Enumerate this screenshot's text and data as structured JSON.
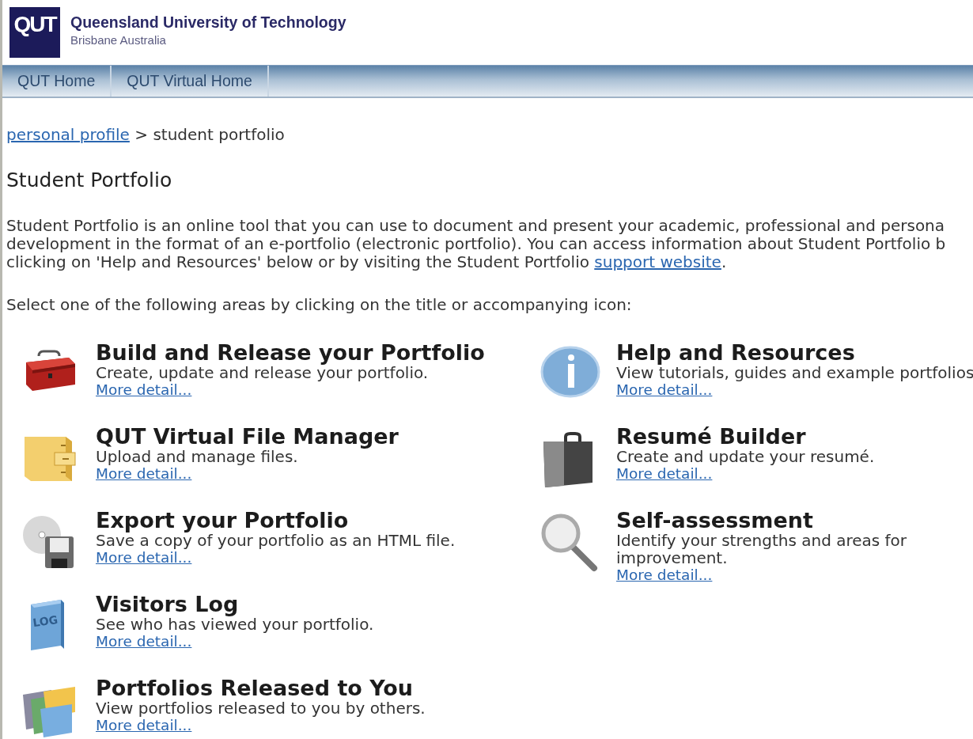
{
  "header": {
    "logo": "QUT",
    "name": "Queensland University of Technology",
    "place": "Brisbane Australia"
  },
  "nav": [
    {
      "label": "QUT Home"
    },
    {
      "label": "QUT Virtual Home"
    }
  ],
  "breadcrumb": {
    "link": "personal profile",
    "separator": ">",
    "current": "student portfolio"
  },
  "heading": "Student Portfolio",
  "intro": {
    "lines": [
      "Student Portfolio is an online tool that you can use to document and present your academic, professional and persona",
      "development in the format of an e-portfolio (electronic portfolio). You can access information about Student Portfolio b",
      "clicking on 'Help and Resources' below or by visiting the Student Portfolio "
    ],
    "link": "support website",
    "after": "."
  },
  "instruction": "Select one of the following areas by clicking on the title or accompanying icon:",
  "columns": [
    [
      {
        "kind": "toolbox",
        "title": "Build and Release your Portfolio",
        "description": [
          "Create, update and release your portfolio."
        ],
        "link": "More detail..."
      },
      {
        "kind": "cabinet",
        "title": "QUT Virtual File Manager",
        "description": [
          "Upload and manage files."
        ],
        "link": "More detail..."
      },
      {
        "kind": "export",
        "title": "Export your Portfolio",
        "description": [
          "Save a copy of your portfolio as an HTML file."
        ],
        "link": "More detail..."
      },
      {
        "kind": "book",
        "icon_text": "LOG",
        "title": "Visitors Log",
        "description": [
          "See who has viewed your portfolio."
        ],
        "link": "More detail..."
      },
      {
        "kind": "folders",
        "title": "Portfolios Released to You",
        "description": [
          "View portfolios released to you by others."
        ],
        "link": "More detail..."
      }
    ],
    [
      {
        "kind": "info",
        "title": "Help and Resources",
        "description": [
          "View tutorials, guides and example portfolios"
        ],
        "link": "More detail..."
      },
      {
        "kind": "briefcase",
        "title": "Resumé Builder",
        "description": [
          "Create and update your resumé."
        ],
        "link": "More detail..."
      },
      {
        "kind": "magnifier",
        "title": "Self-assessment",
        "description": [
          "Identify your strengths and areas for",
          "improvement."
        ],
        "link": "More detail..."
      }
    ]
  ]
}
